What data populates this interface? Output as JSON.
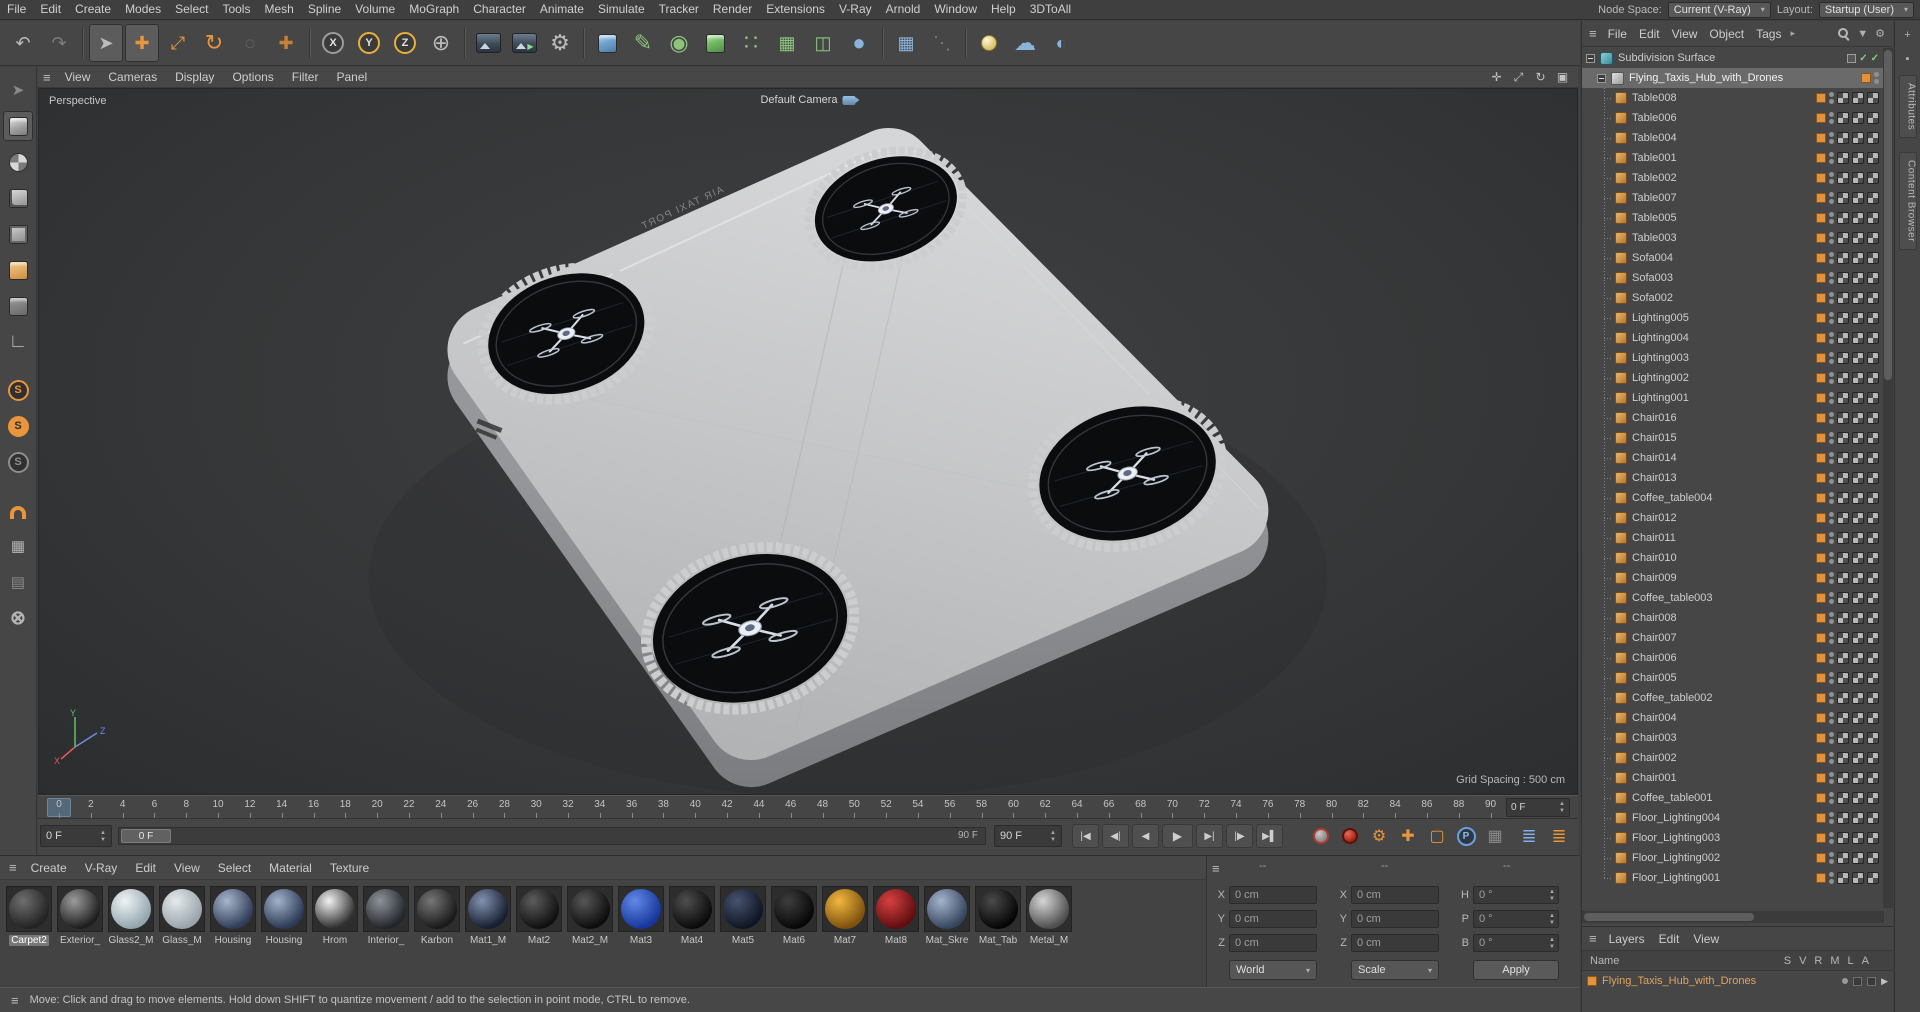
{
  "icons": {
    "hamburger": "≡",
    "arrow_right": "▸",
    "dropdown": "▾",
    "up": "▲",
    "down": "▼",
    "check": "✓",
    "play": "▶"
  },
  "menubar": {
    "items": [
      "File",
      "Edit",
      "Create",
      "Modes",
      "Select",
      "Tools",
      "Mesh",
      "Spline",
      "Volume",
      "MoGraph",
      "Character",
      "Animate",
      "Simulate",
      "Tracker",
      "Render",
      "Extensions",
      "V-Ray",
      "Arnold",
      "Window",
      "Help",
      "3DToAll"
    ],
    "node_space_label": "Node Space:",
    "node_space_value": "Current (V-Ray)",
    "layout_label": "Layout:",
    "layout_value": "Startup (User)"
  },
  "toolbar": {
    "icons": [
      {
        "name": "undo-icon",
        "glyph": "↶"
      },
      {
        "name": "redo-icon",
        "glyph": "↷",
        "cls": "dim"
      },
      {
        "type": "sep"
      },
      {
        "name": "live-selection-icon",
        "glyph": "➤",
        "cls": "pressed"
      },
      {
        "name": "move-tool-icon",
        "glyph": "✚",
        "cls": "orange pressed"
      },
      {
        "name": "scale-tool-icon",
        "glyph": "⤢",
        "cls": "orange"
      },
      {
        "name": "rotate-tool-icon",
        "glyph": "↻",
        "cls": "orange big"
      },
      {
        "name": "last-tool-icon",
        "glyph": "◌",
        "cls": "dim"
      },
      {
        "name": "free-move-icon",
        "glyph": "✚",
        "cls": "dim2"
      },
      {
        "type": "sep"
      },
      {
        "name": "x-axis-lock-icon",
        "shape": "axis-circle",
        "letter": "X"
      },
      {
        "name": "y-axis-lock-icon",
        "shape": "axis-circle on",
        "letter": "Y"
      },
      {
        "name": "z-axis-lock-icon",
        "shape": "axis-circle on",
        "letter": "Z"
      },
      {
        "name": "coordinate-system-icon",
        "glyph": "⊕",
        "cls": "big"
      },
      {
        "type": "sep"
      },
      {
        "name": "render-view-icon",
        "shape": "rv-sq"
      },
      {
        "name": "render-picture-viewer-icon",
        "shape": "rv-sq play"
      },
      {
        "name": "render-settings-icon",
        "glyph": "⚙",
        "cls": "big"
      },
      {
        "type": "sep"
      },
      {
        "name": "add-cube-icon",
        "shape": "cube-sh"
      },
      {
        "name": "spline-pen-icon",
        "glyph": "✎",
        "cls": "green big"
      },
      {
        "name": "subdivision-surface-icon",
        "glyph": "◉",
        "cls": "green big"
      },
      {
        "name": "extrude-icon",
        "shape": "cube-sh green"
      },
      {
        "name": "array-icon",
        "glyph": "∷",
        "cls": "green big"
      },
      {
        "name": "instance-icon",
        "glyph": "▦",
        "cls": "green"
      },
      {
        "name": "symmetry-icon",
        "glyph": "◫",
        "cls": "green"
      },
      {
        "name": "metaball-icon",
        "glyph": "●",
        "cls": "blue big"
      },
      {
        "type": "sep"
      },
      {
        "name": "cloner-icon",
        "glyph": "▦",
        "cls": "blue"
      },
      {
        "name": "tracer-icon",
        "glyph": "⋱",
        "cls": "dim"
      },
      {
        "type": "sep"
      },
      {
        "name": "light-icon",
        "shape": "bulb"
      },
      {
        "name": "sky-icon",
        "glyph": "☁",
        "cls": "blue big"
      },
      {
        "name": "physical-sky-icon",
        "glyph": "◐",
        "cls": "blue"
      }
    ]
  },
  "palette": {
    "icons": [
      {
        "name": "tweak-tool-icon",
        "glyph": "➤",
        "cls": "dim"
      },
      {
        "name": "model-mode-icon",
        "shape": "cube-sh gray",
        "cls": "pressed"
      },
      {
        "name": "texture-mode-icon",
        "shape": "ball-check"
      },
      {
        "name": "points-mode-icon",
        "shape": "cube-sh dots"
      },
      {
        "name": "edges-mode-icon",
        "shape": "cube-sh edges"
      },
      {
        "name": "polygons-mode-icon",
        "shape": "cube-sh poly"
      },
      {
        "name": "uv-mode-icon",
        "shape": "cube-sh dim"
      },
      {
        "name": "workplane-icon",
        "glyph": "∟",
        "cls": "big"
      },
      {
        "type": "gap"
      },
      {
        "name": "solo-off-icon",
        "shape": "s-circ",
        "letter": "S"
      },
      {
        "name": "solo-single-icon",
        "shape": "s-circ fill",
        "letter": "S"
      },
      {
        "name": "solo-hierarchy-icon",
        "shape": "s-circ dim",
        "letter": "S"
      },
      {
        "type": "gap"
      },
      {
        "name": "snap-icon",
        "shape": "magnet"
      },
      {
        "name": "quantize-icon",
        "glyph": "▦"
      },
      {
        "name": "workplane-snap-icon",
        "glyph": "▤",
        "cls": "dim"
      },
      {
        "name": "axis-modification-icon",
        "glyph": "⊗",
        "cls": "big"
      }
    ]
  },
  "viewport": {
    "menu": [
      "View",
      "Cameras",
      "Display",
      "Options",
      "Filter",
      "Panel"
    ],
    "nav_icons": [
      {
        "name": "pan-view-icon",
        "glyph": "✛"
      },
      {
        "name": "dolly-view-icon",
        "glyph": "⤢"
      },
      {
        "name": "orbit-view-icon",
        "glyph": "↻"
      },
      {
        "name": "toggle-view-icon",
        "glyph": "▣"
      }
    ],
    "view_label": "Perspective",
    "camera_label": "Default Camera",
    "grid_spacing": "Grid Spacing : 500 cm",
    "port_text": "AIR TAXI PORT",
    "axis_labels": {
      "x": "X",
      "y": "Y",
      "z": "Z"
    }
  },
  "timeline": {
    "ticks": [
      "0",
      "2",
      "4",
      "6",
      "8",
      "10",
      "12",
      "14",
      "16",
      "18",
      "20",
      "22",
      "24",
      "26",
      "28",
      "30",
      "32",
      "34",
      "36",
      "38",
      "40",
      "42",
      "44",
      "46",
      "48",
      "50",
      "52",
      "54",
      "56",
      "58",
      "60",
      "62",
      "64",
      "66",
      "68",
      "70",
      "72",
      "74",
      "76",
      "78",
      "80",
      "82",
      "84",
      "86",
      "88",
      "90"
    ],
    "current_frame": "0 F"
  },
  "transport": {
    "start_frame": "0 F",
    "slider_handle": "0 F",
    "slider_end": "90 F",
    "end_frame": "90 F",
    "buttons": [
      {
        "name": "goto-start-button",
        "glyph": "|◀"
      },
      {
        "name": "prev-key-button",
        "glyph": "◀|"
      },
      {
        "name": "prev-frame-button",
        "glyph": "◀"
      },
      {
        "name": "play-button",
        "glyph": "▶",
        "cls": "play"
      },
      {
        "name": "next-frame-button",
        "glyph": "▶|"
      },
      {
        "name": "next-key-button",
        "glyph": "|▶"
      },
      {
        "name": "goto-end-button",
        "glyph": "▶▌"
      }
    ],
    "key_icons": [
      {
        "name": "record-keyframe-icon",
        "shape": "rec-gray"
      },
      {
        "name": "autokey-icon",
        "shape": "rec-red"
      },
      {
        "name": "keyframe-selection-icon",
        "glyph": "⚙",
        "cls": "orange"
      },
      {
        "name": "record-position-icon",
        "glyph": "✚",
        "cls": "orange"
      },
      {
        "name": "record-scale-icon",
        "glyph": "▢",
        "cls": "orange"
      },
      {
        "name": "record-parameter-icon",
        "shape": "p-circ",
        "letter": "P"
      },
      {
        "name": "record-pla-icon",
        "glyph": "▦",
        "cls": "dim"
      }
    ],
    "right_icons": [
      {
        "name": "preview-range-icon",
        "glyph": "≣",
        "cls": "blue"
      },
      {
        "name": "timeline-options-icon",
        "glyph": "≣",
        "cls": "orange"
      }
    ]
  },
  "materials": {
    "menu": [
      "Create",
      "V-Ray",
      "Edit",
      "View",
      "Select",
      "Material",
      "Texture"
    ],
    "items": [
      {
        "name": "Carpet2",
        "c1": "#6e6e6e",
        "c2": "#232323",
        "selected": true
      },
      {
        "name": "Exterior_",
        "c1": "#9c9c9c",
        "c2": "#1e1e1e"
      },
      {
        "name": "Glass2_M",
        "c1": "#eef3f5",
        "c2": "#93a6ae"
      },
      {
        "name": "Glass_M",
        "c1": "#e4e9ec",
        "c2": "#9aa5ab"
      },
      {
        "name": "Housing",
        "c1": "#a8b6cc",
        "c2": "#2f3d58"
      },
      {
        "name": "Housing",
        "c1": "#a2b2c9",
        "c2": "#2b3a55"
      },
      {
        "name": "Hrom",
        "c1": "#f2f2f2",
        "c2": "#2e2e2e"
      },
      {
        "name": "Interior_",
        "c1": "#8e939b",
        "c2": "#22252a"
      },
      {
        "name": "Karbon",
        "c1": "#767676",
        "c2": "#1a1a1a"
      },
      {
        "name": "Mat1_M",
        "c1": "#8292b0",
        "c2": "#161e30"
      },
      {
        "name": "Mat2",
        "c1": "#5c5c5c",
        "c2": "#101010"
      },
      {
        "name": "Mat2_M",
        "c1": "#565656",
        "c2": "#0d0d0d"
      },
      {
        "name": "Mat3",
        "c1": "#6189e8",
        "c2": "#16369b"
      },
      {
        "name": "Mat4",
        "c1": "#4e4e4e",
        "c2": "#0b0b0b"
      },
      {
        "name": "Mat5",
        "c1": "#46536f",
        "c2": "#0f1524"
      },
      {
        "name": "Mat6",
        "c1": "#3e3e3e",
        "c2": "#070707"
      },
      {
        "name": "Mat7",
        "c1": "#f3b73e",
        "c2": "#7d520e"
      },
      {
        "name": "Mat8",
        "c1": "#d64040",
        "c2": "#5f0e10"
      },
      {
        "name": "Mat_Skre",
        "c1": "#a4b4cb",
        "c2": "#35465f"
      },
      {
        "name": "Mat_Tab",
        "c1": "#4a4a4a",
        "c2": "#050505"
      },
      {
        "name": "Metal_M",
        "c1": "#d6d6d6",
        "c2": "#4e4e4e"
      }
    ]
  },
  "coordinates": {
    "headers": [
      "--",
      "--",
      "--"
    ],
    "position": [
      {
        "label": "X",
        "value": "0 cm"
      },
      {
        "label": "Y",
        "value": "0 cm"
      },
      {
        "label": "Z",
        "value": "0 cm"
      }
    ],
    "size": [
      {
        "label": "X",
        "value": "0 cm"
      },
      {
        "label": "Y",
        "value": "0 cm"
      },
      {
        "label": "Z",
        "value": "0 cm"
      }
    ],
    "rotation": [
      {
        "label": "H",
        "value": "0 °"
      },
      {
        "label": "P",
        "value": "0 °"
      },
      {
        "label": "B",
        "value": "0 °"
      }
    ],
    "world": "World",
    "scale_mode": "Scale",
    "apply": "Apply"
  },
  "object_manager": {
    "menu": [
      "File",
      "Edit",
      "View",
      "Object",
      "Tags"
    ],
    "root": "Subdivision Surface",
    "parent": "Flying_Taxis_Hub_with_Drones",
    "children": [
      "Table008",
      "Table006",
      "Table004",
      "Table001",
      "Table002",
      "Table007",
      "Table005",
      "Table003",
      "Sofa004",
      "Sofa003",
      "Sofa002",
      "Lighting005",
      "Lighting004",
      "Lighting003",
      "Lighting002",
      "Lighting001",
      "Chair016",
      "Chair015",
      "Chair014",
      "Chair013",
      "Coffee_table004",
      "Chair012",
      "Chair011",
      "Chair010",
      "Chair009",
      "Coffee_table003",
      "Chair008",
      "Chair007",
      "Chair006",
      "Chair005",
      "Coffee_table002",
      "Chair004",
      "Chair003",
      "Chair002",
      "Chair001",
      "Coffee_table001",
      "Floor_Lighting004",
      "Floor_Lighting003",
      "Floor_Lighting002",
      "Floor_Lighting001"
    ]
  },
  "layers": {
    "menu": [
      "Layers",
      "Edit",
      "View"
    ],
    "name_header": "Name",
    "columns": [
      "S",
      "V",
      "R",
      "M",
      "L",
      "A"
    ],
    "item": "Flying_Taxis_Hub_with_Drones"
  },
  "side_tabs": [
    "Attributes",
    "Content Browser"
  ],
  "status": {
    "text": "Move: Click and drag to move elements. Hold down SHIFT to quantize movement / add to the selection in point mode, CTRL to remove."
  }
}
